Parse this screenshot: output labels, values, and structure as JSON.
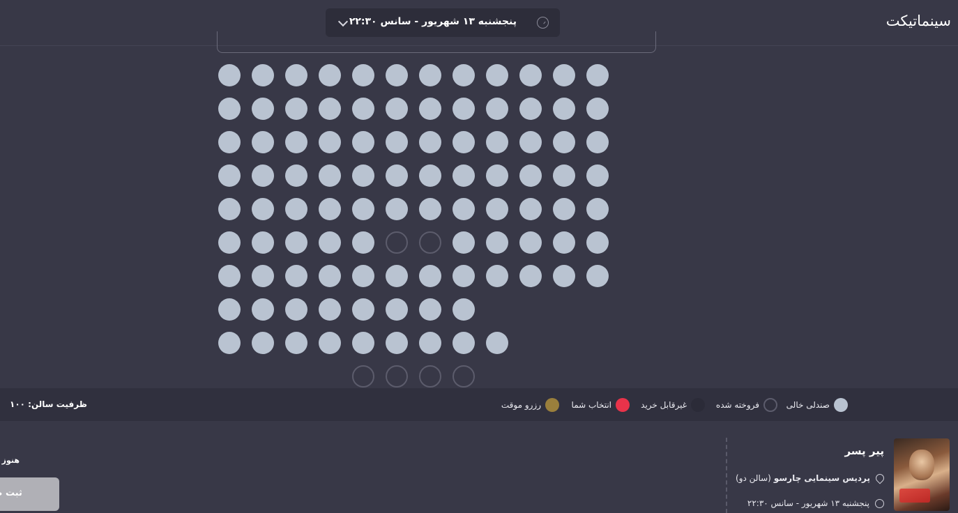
{
  "header": {
    "logo": "سینماتیکت",
    "session_label": "پنجشنبه ۱۳ شهریور - سانس ۲۲:۳۰"
  },
  "colors": {
    "background": "#383847",
    "seat_empty": "#b9c3d1",
    "seat_sold_ring": "#5c5c6c",
    "unavailable": "#2b2b38",
    "your_selection": "#e8334a",
    "temp_reserved": "#9a7f3c"
  },
  "seat_map": {
    "rows": [
      [
        "e",
        "e",
        "e",
        "e",
        "e",
        "e",
        "e",
        "e",
        "e",
        "e",
        "e",
        "e"
      ],
      [
        "e",
        "e",
        "e",
        "e",
        "e",
        "e",
        "e",
        "e",
        "e",
        "e",
        "e",
        "e"
      ],
      [
        "e",
        "e",
        "e",
        "e",
        "e",
        "e",
        "e",
        "e",
        "e",
        "e",
        "e",
        "e"
      ],
      [
        "e",
        "e",
        "e",
        "e",
        "e",
        "e",
        "e",
        "e",
        "e",
        "e",
        "e",
        "e"
      ],
      [
        "e",
        "e",
        "e",
        "e",
        "e",
        "e",
        "e",
        "e",
        "e",
        "e",
        "e",
        "e"
      ],
      [
        "e",
        "e",
        "e",
        "e",
        "e",
        "s",
        "s",
        "e",
        "e",
        "e",
        "e",
        "e"
      ],
      [
        "e",
        "e",
        "e",
        "e",
        "e",
        "e",
        "e",
        "e",
        "e",
        "e",
        "e",
        "e"
      ],
      [
        "e",
        "e",
        "e",
        "e",
        "e",
        "e",
        "e",
        "e",
        "",
        "",
        "",
        ""
      ],
      [
        "e",
        "e",
        "e",
        "e",
        "e",
        "e",
        "e",
        "e",
        "e",
        "",
        "",
        ""
      ],
      [
        "",
        "",
        "",
        "",
        "s",
        "s",
        "s",
        "s",
        "",
        "",
        "",
        ""
      ]
    ]
  },
  "legend": {
    "items": [
      {
        "label": "صندلی خالی",
        "icon": "empty-seat-dot"
      },
      {
        "label": "فروخته شده",
        "icon": "sold-seat-dot"
      },
      {
        "label": "غیرقابل خرید",
        "icon": "unavailable-seat-dot"
      },
      {
        "label": "انتخاب شما",
        "icon": "selected-seat-dot"
      },
      {
        "label": "رزرو موقت",
        "icon": "reserved-seat-dot"
      }
    ],
    "capacity": "ظرفیت سالن: ۱۰۰"
  },
  "movie": {
    "title": "پیر پسر",
    "cinema": "پردیس سینمایی چارسو",
    "hall": "(سالن دو)",
    "datetime": "پنجشنبه ۱۳ شهریور - سانس ۲۲:۳۰"
  },
  "checkout": {
    "not_yet_text": "هنوز ب",
    "submit_label": "ثبت صندلی"
  }
}
